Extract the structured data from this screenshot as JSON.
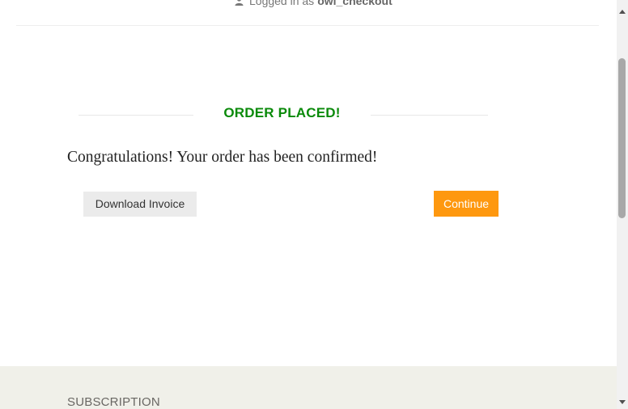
{
  "header": {
    "login_prefix": "Logged in as",
    "username": "owl_checkout",
    "user_icon": "user-icon"
  },
  "order": {
    "title": "ORDER PLACED!",
    "title_color": "#0a8a0a",
    "message": "Congratulations! Your order has been confirmed!",
    "download_label": "Download Invoice",
    "continue_label": "Continue",
    "continue_color": "#fe980f"
  },
  "footer": {
    "heading": "SUBSCRIPTION",
    "background": "#f0f0e9"
  },
  "scrollbar": {
    "up_icon": "scroll-up-arrow-icon",
    "down_icon": "scroll-down-arrow-icon"
  }
}
